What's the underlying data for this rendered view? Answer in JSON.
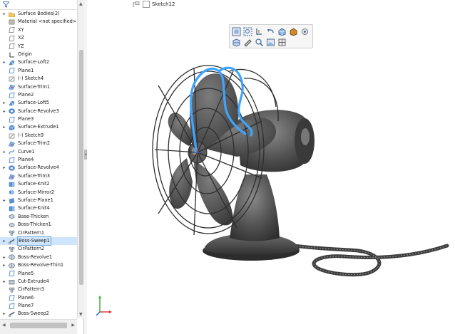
{
  "feature_tree": {
    "items": [
      {
        "label": "Surface Bodies(2)",
        "icon": "surface-bodies-folder-icon",
        "expander": "▸",
        "color": "#d9a13b"
      },
      {
        "label": "Material <not specified>",
        "icon": "material-icon",
        "expander": "",
        "color": "#6b6b6b"
      },
      {
        "label": "XY",
        "icon": "plane-icon",
        "expander": "",
        "color": "#7a7a7a"
      },
      {
        "label": "XZ",
        "icon": "plane-icon",
        "expander": "",
        "color": "#7a7a7a"
      },
      {
        "label": "YZ",
        "icon": "plane-icon",
        "expander": "",
        "color": "#7a7a7a"
      },
      {
        "label": "Origin",
        "icon": "origin-icon",
        "expander": "",
        "color": "#333333"
      },
      {
        "label": "Surface-Loft2",
        "icon": "surface-loft-icon",
        "expander": "▸",
        "color": "#3c78c3"
      },
      {
        "label": "Plane1",
        "icon": "plane-icon",
        "expander": "",
        "color": "#3c78c3"
      },
      {
        "label": "(-) Sketch4",
        "icon": "sketch-icon",
        "expander": "",
        "color": "#555555"
      },
      {
        "label": "Surface-Trim1",
        "icon": "surface-trim-icon",
        "expander": "",
        "color": "#3c78c3"
      },
      {
        "label": "Plane2",
        "icon": "plane-icon",
        "expander": "",
        "color": "#3c78c3"
      },
      {
        "label": "Surface-Loft5",
        "icon": "surface-loft-icon",
        "expander": "▸",
        "color": "#3c78c3"
      },
      {
        "label": "Surface-Revolve3",
        "icon": "surface-revolve-icon",
        "expander": "▸",
        "color": "#3c78c3"
      },
      {
        "label": "Plane3",
        "icon": "plane-icon",
        "expander": "",
        "color": "#3c78c3"
      },
      {
        "label": "Surface-Extrude1",
        "icon": "surface-extrude-icon",
        "expander": "▸",
        "color": "#3c78c3"
      },
      {
        "label": "(-) Sketch9",
        "icon": "sketch-icon",
        "expander": "",
        "color": "#555555"
      },
      {
        "label": "Surface-Trim2",
        "icon": "surface-trim-icon",
        "expander": "",
        "color": "#3c78c3"
      },
      {
        "label": "Curve1",
        "icon": "curve-icon",
        "expander": "▸",
        "color": "#3c78c3"
      },
      {
        "label": "Plane4",
        "icon": "plane-icon",
        "expander": "",
        "color": "#3c78c3"
      },
      {
        "label": "Surface-Revolve4",
        "icon": "surface-revolve-icon",
        "expander": "▸",
        "color": "#3c78c3"
      },
      {
        "label": "Surface-Trim3",
        "icon": "surface-trim-icon",
        "expander": "",
        "color": "#3c78c3"
      },
      {
        "label": "Surface-Knit2",
        "icon": "surface-knit-icon",
        "expander": "",
        "color": "#3c78c3"
      },
      {
        "label": "Surface-Mirror2",
        "icon": "surface-mirror-icon",
        "expander": "",
        "color": "#3c78c3"
      },
      {
        "label": "Surface-Plane1",
        "icon": "surface-plane-icon",
        "expander": "▸",
        "color": "#3c78c3"
      },
      {
        "label": "Surface-Knit4",
        "icon": "surface-knit-icon",
        "expander": "",
        "color": "#3c78c3"
      },
      {
        "label": "Base-Thicken",
        "icon": "thicken-icon",
        "expander": "",
        "color": "#5f6b78"
      },
      {
        "label": "Boss-Thicken1",
        "icon": "thicken-icon",
        "expander": "",
        "color": "#5f6b78"
      },
      {
        "label": "CirPattern1",
        "icon": "circular-pattern-icon",
        "expander": "",
        "color": "#5f6b78"
      },
      {
        "label": "Boss-Sweep1",
        "icon": "sweep-icon",
        "expander": "▸",
        "color": "#5f6b78",
        "selected": true
      },
      {
        "label": "CirPattern2",
        "icon": "circular-pattern-icon",
        "expander": "",
        "color": "#5f6b78"
      },
      {
        "label": "Boss-Revolve1",
        "icon": "revolve-icon",
        "expander": "▸",
        "color": "#5f6b78"
      },
      {
        "label": "Boss-Revolve-Thin1",
        "icon": "revolve-icon",
        "expander": "▸",
        "color": "#5f6b78"
      },
      {
        "label": "Plane5",
        "icon": "plane-icon",
        "expander": "",
        "color": "#3c78c3"
      },
      {
        "label": "Cut-Extrude4",
        "icon": "cut-extrude-icon",
        "expander": "▸",
        "color": "#5f6b78"
      },
      {
        "label": "CirPattern3",
        "icon": "circular-pattern-icon",
        "expander": "",
        "color": "#5f6b78"
      },
      {
        "label": "Plane6",
        "icon": "plane-icon",
        "expander": "",
        "color": "#3c78c3"
      },
      {
        "label": "Plane7",
        "icon": "plane-icon",
        "expander": "",
        "color": "#3c78c3"
      },
      {
        "label": "Boss-Sweep2",
        "icon": "sweep-icon",
        "expander": "▸",
        "color": "#5f6b78"
      }
    ],
    "rollback_bar_color": "#2f6fb0"
  },
  "viewport": {
    "active_sketch": "Sketch12",
    "selection_color": "#3da5ff",
    "model_color": "#5a5a5a"
  },
  "heads_up_toolbar": {
    "row1": [
      "zoom-to-fit-icon",
      "zoom-to-area-icon",
      "previous-view-icon",
      "undo-icon",
      "view-orientation-icon",
      "display-style-icon",
      "hide-show-icon"
    ],
    "row2": [
      "section-view-icon",
      "edit-appearance-icon",
      "zoom-icon",
      "apply-scene-icon",
      "view-settings-icon"
    ]
  },
  "triad": {
    "x_label": "",
    "y_label": "",
    "z_label": ""
  }
}
